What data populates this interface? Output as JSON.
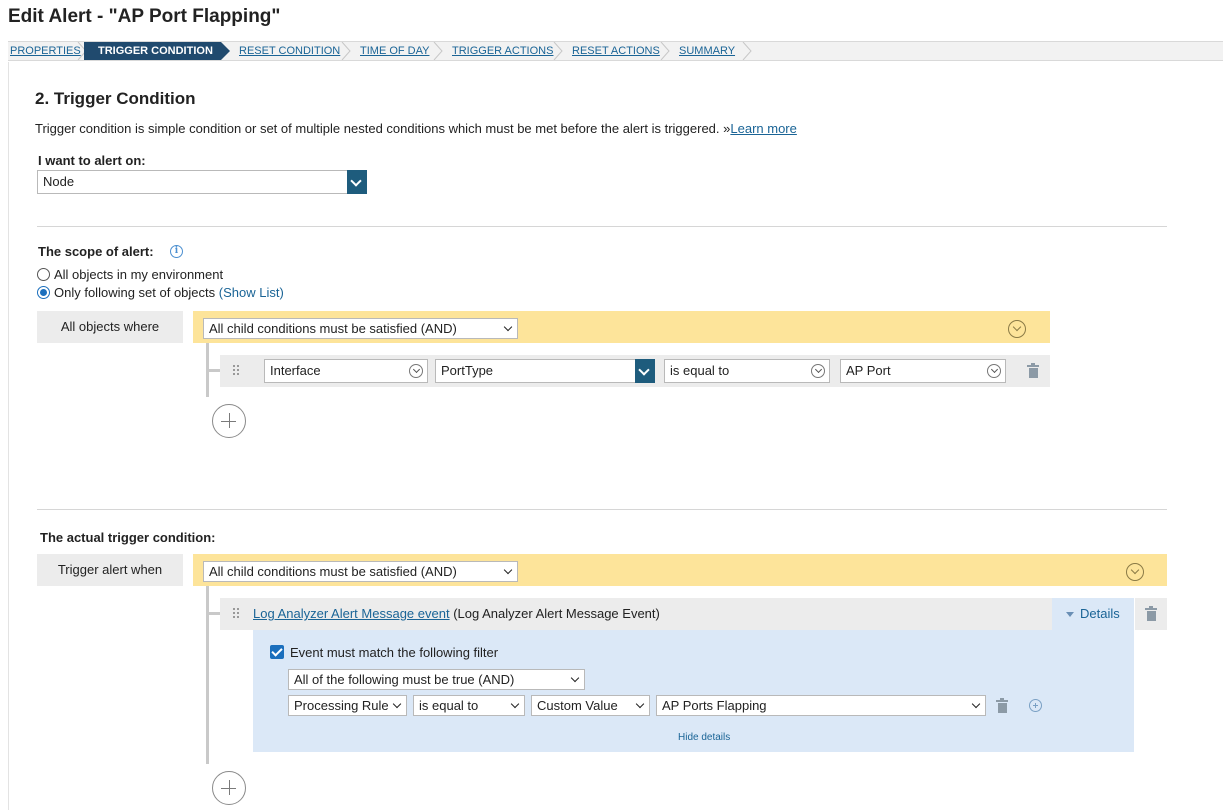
{
  "page": {
    "title": "Edit Alert - \"AP Port Flapping\""
  },
  "wizard": {
    "steps": [
      {
        "label": "PROPERTIES",
        "active": false
      },
      {
        "label": "TRIGGER CONDITION",
        "active": true
      },
      {
        "label": "RESET CONDITION",
        "active": false
      },
      {
        "label": "TIME OF DAY",
        "active": false
      },
      {
        "label": "TRIGGER ACTIONS",
        "active": false
      },
      {
        "label": "RESET ACTIONS",
        "active": false
      },
      {
        "label": "SUMMARY",
        "active": false
      }
    ]
  },
  "section": {
    "heading": "2. Trigger Condition",
    "description": "Trigger condition is simple condition or set of multiple nested conditions which must be met before the alert is triggered. »",
    "learn_more": "Learn more"
  },
  "alert_on": {
    "label": "I want to alert on:",
    "value": "Node"
  },
  "scope": {
    "label": "The scope of alert:",
    "info_icon": "info-icon",
    "options": [
      {
        "label": "All objects in my environment",
        "selected": false
      },
      {
        "label": "Only following set of objects",
        "selected": true
      }
    ],
    "show_list": "(Show List)",
    "group_label": "All objects where",
    "group_operator": "All child conditions must be satisfied (AND)",
    "condition": {
      "object": "Interface",
      "field": "PortType",
      "operator": "is equal to",
      "value": "AP Port"
    }
  },
  "trigger": {
    "label": "The actual trigger condition:",
    "group_label": "Trigger alert when",
    "group_operator": "All child conditions must be satisfied (AND)",
    "event": {
      "link": "Log Analyzer Alert Message event",
      "suffix": "(Log Analyzer Alert Message Event)",
      "details": "Details",
      "filter_checkbox": "Event must match the following filter",
      "filter_checked": true,
      "filter_operator": "All of the following must be true (AND)",
      "rule": {
        "field": "Processing Rule",
        "operator": "is equal to",
        "value_type": "Custom Value",
        "value": "AP Ports Flapping"
      },
      "hide_details": "Hide details"
    }
  },
  "colors": {
    "active_step": "#204a6e",
    "link": "#1a6496",
    "yellow_bar": "#fde49a",
    "details_panel": "#dbe8f7",
    "dropdown_button": "#1e5c7d"
  }
}
